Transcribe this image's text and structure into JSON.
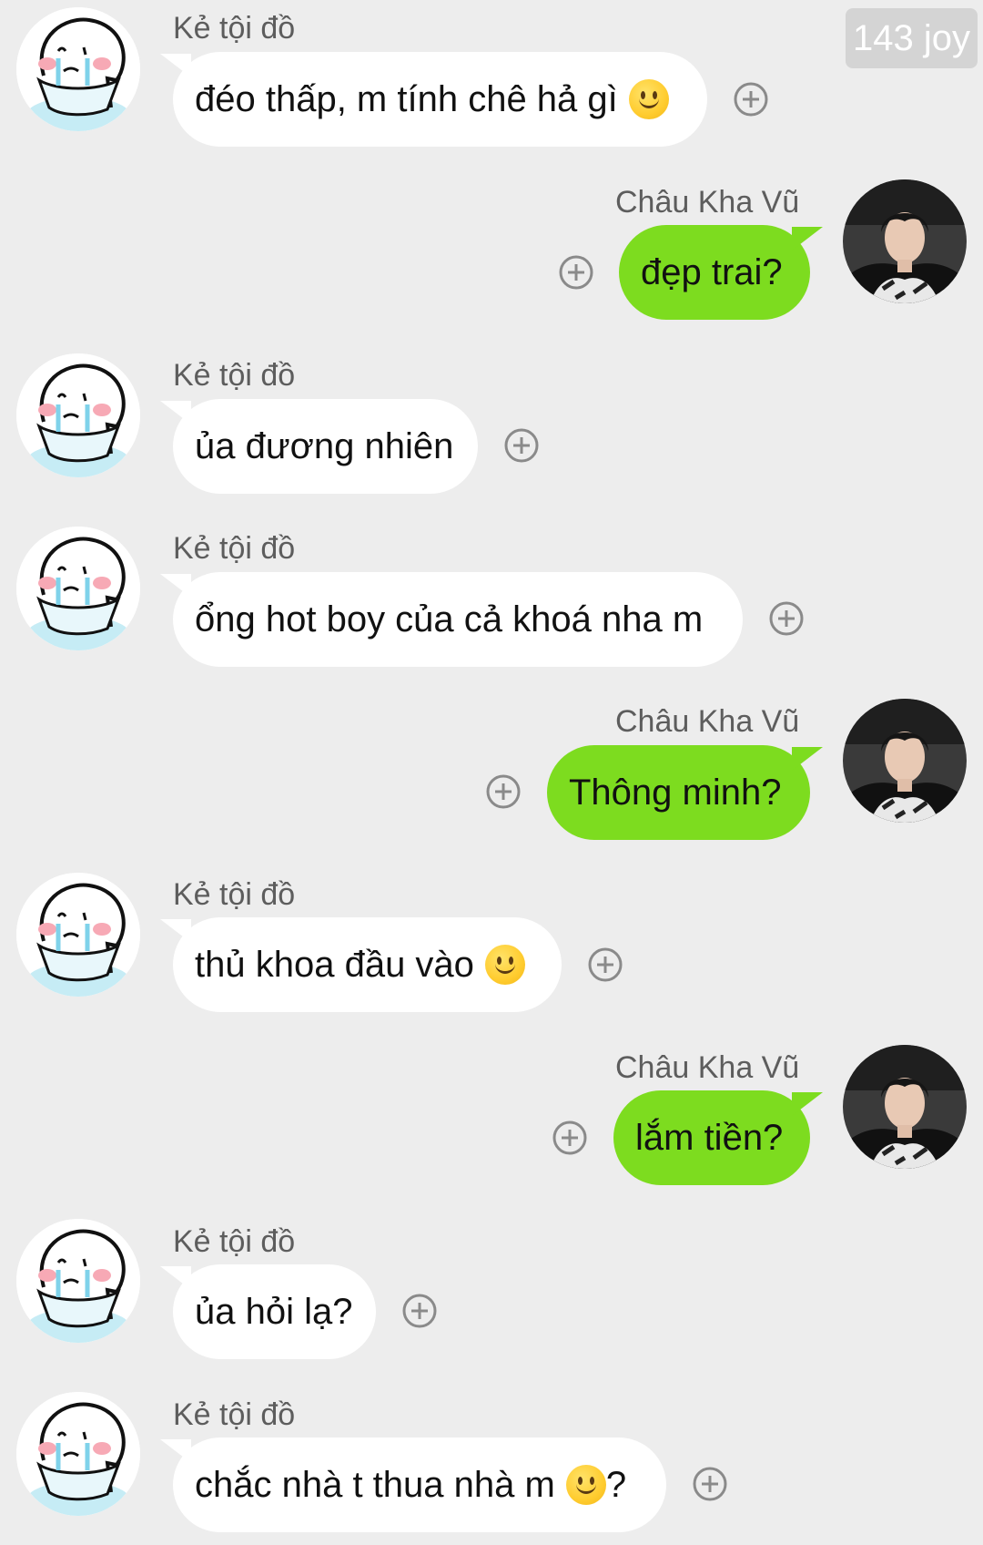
{
  "watermark": "143 joy",
  "contacts": {
    "other": {
      "name": "Kẻ tội đồ",
      "avatar_icon": "crying-sticker-icon"
    },
    "me": {
      "name": "Châu Kha Vũ",
      "avatar_icon": "profile-photo-icon"
    }
  },
  "colors": {
    "background": "#ededed",
    "incoming_bubble": "#ffffff",
    "outgoing_bubble": "#7ddc1f",
    "name_text": "#5d5d5d"
  },
  "messages": [
    {
      "sender": "Kẻ tội đồ",
      "text": "đéo thấp, m tính chê hả gì ",
      "emoji": "slightly-smiling-face-icon",
      "suffix": ""
    },
    {
      "sender": "Châu Kha Vũ",
      "text": "đẹp trai?"
    },
    {
      "sender": "Kẻ tội đồ",
      "text": "ủa đương nhiên"
    },
    {
      "sender": "Kẻ tội đồ",
      "text": "ổng hot boy của cả khoá nha m"
    },
    {
      "sender": "Châu Kha Vũ",
      "text": "Thông minh?"
    },
    {
      "sender": "Kẻ tội đồ",
      "text": "thủ khoa đầu vào ",
      "emoji": "slightly-smiling-face-icon",
      "suffix": ""
    },
    {
      "sender": "Châu Kha Vũ",
      "text": "lắm tiền?"
    },
    {
      "sender": "Kẻ tội đồ",
      "text": "ủa hỏi lạ?"
    },
    {
      "sender": "Kẻ tội đồ",
      "text": "chắc nhà t thua nhà m ",
      "emoji": "slightly-smiling-face-icon",
      "suffix": "?"
    }
  ]
}
